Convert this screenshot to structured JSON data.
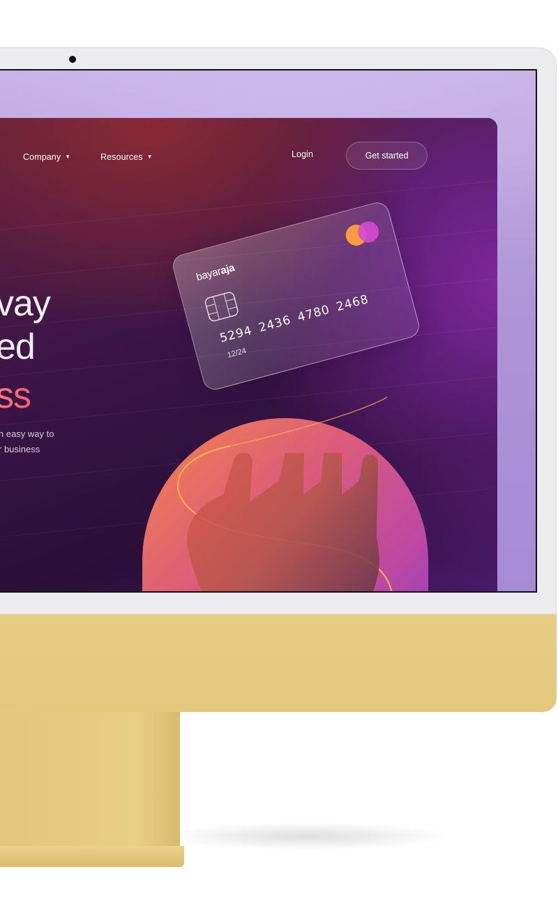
{
  "nav": {
    "company_label": "Company",
    "resources_label": "Resources",
    "login_label": "Login",
    "get_started_label": "Get started",
    "caret": "▼"
  },
  "hero": {
    "line1": "vay",
    "line2": "ed",
    "line3": "ss",
    "sub1": "n easy way to",
    "sub2": "r business"
  },
  "card": {
    "brand_regular": "bayar",
    "brand_bold": "aja",
    "number": "5294 2436 4780 2468",
    "expiry": "12/24"
  },
  "colors": {
    "device": "#e5cb80",
    "screen_bezel": "#ececef",
    "accent_title": "#ff6b78",
    "mastercard_left": "#ff9a3d",
    "mastercard_right": "#d64bd4"
  }
}
